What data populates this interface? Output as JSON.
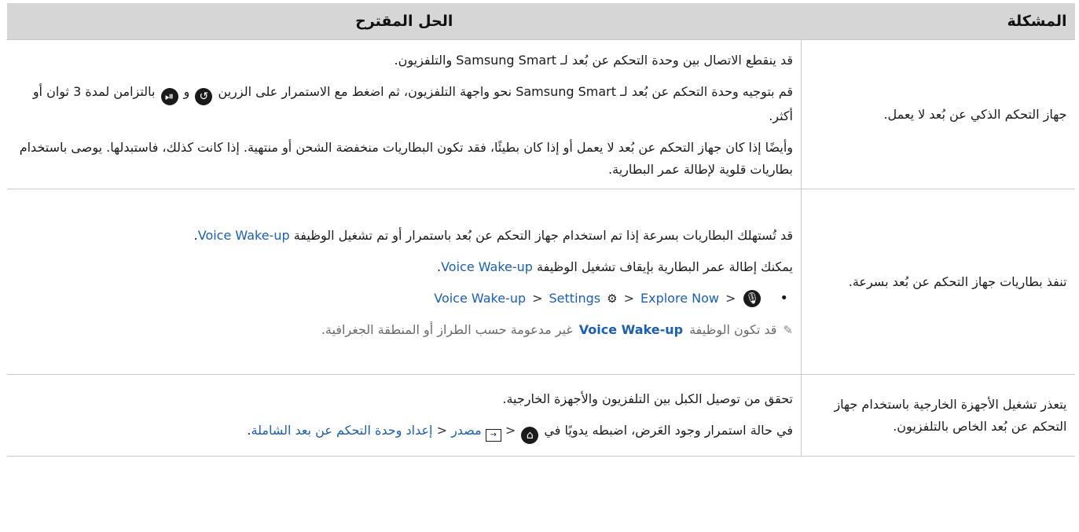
{
  "table": {
    "header_problem": "المشكلة",
    "header_solution": "الحل المقترح"
  },
  "rows": [
    {
      "problem": "جهاز التحكم الذكي عن بُعد لا يعمل.",
      "p1": "قد ينقطع الاتصال بين وحدة التحكم عن بُعد لـ Samsung Smart والتلفزيون.",
      "p2a": "قم بتوجيه وحدة التحكم عن بُعد لـ Samsung Smart نحو واجهة التلفزيون، ثم اضغط مع الاستمرار على الزرين",
      "p2_and": "و",
      "p2b": "بالتزامن لمدة 3 ثوان أو أكثر.",
      "p3": "وأيضًا إذا كان جهاز التحكم عن بُعد لا يعمل أو إذا كان بطيئًا، فقد تكون البطاريات منخفضة الشحن أو منتهية. إذا كانت كذلك، فاستبدلها. يوصى باستخدام بطاريات قلوية لإطالة عمر البطارية."
    },
    {
      "problem": "تنفذ بطاريات جهاز التحكم عن بُعد بسرعة.",
      "p1": "قد تُستهلك البطاريات بسرعة إذا تم استخدام جهاز التحكم عن بُعد باستمرار أو تم تشغيل الوظيفة",
      "p1_link": "Voice Wake-up",
      "p2": "يمكنك إطالة عمر البطارية بإيقاف تشغيل الوظيفة",
      "p2_link": "Voice Wake-up",
      "path": [
        "Explore Now",
        "Settings",
        "Voice Wake-up"
      ],
      "note_pre": "قد تكون الوظيفة",
      "note_link": "Voice Wake-up",
      "note_post": "غير مدعومة حسب الطراز أو المنطقة الجغرافية."
    },
    {
      "problem": "يتعذر تشغيل الأجهزة الخارجية باستخدام جهاز التحكم عن بُعد الخاص بالتلفزيون.",
      "p1": "تحقق من توصيل الكبل بين التلفزيون والأجهزة الخارجية.",
      "p2": "في حالة استمرار وجود العَرض، اضبطه يدويًا في",
      "path": [
        "مصدر",
        "إعداد وحدة التحكم عن بعد الشاملة"
      ]
    }
  ],
  "colors": {
    "header_bg": "#d6d6d6",
    "link": "#1a5fb4",
    "note": "#6b6b6b"
  },
  "icons": [
    "return-icon",
    "play-pause-icon",
    "mic-icon",
    "gear-icon",
    "pencil-note-icon",
    "home-icon",
    "source-icon",
    "chevron-left-icon"
  ]
}
